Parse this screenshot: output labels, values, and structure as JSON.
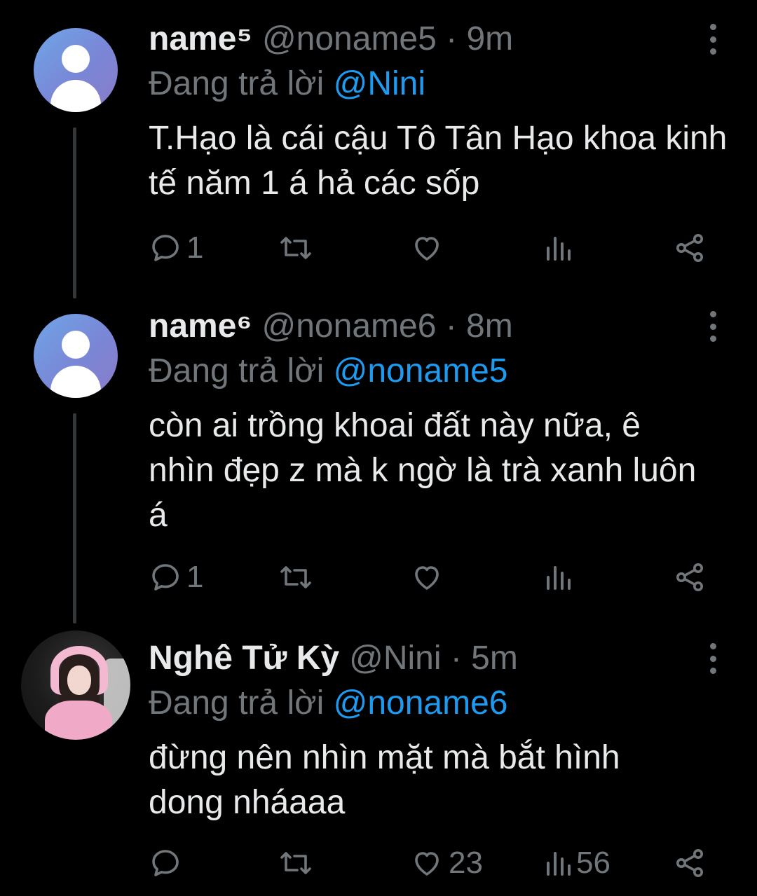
{
  "tweets": [
    {
      "display_name": "name⁵",
      "handle_time": "@noname5 · 9m",
      "replying_prefix": "Đang trả lời",
      "replying_to": "@Nini",
      "text": "T.Hạo là cái cậu Tô Tân Hạo khoa kinh tế năm 1 á hả các sốp",
      "reply_count": "1",
      "retweet_count": "",
      "like_count": "",
      "views_count": "",
      "avatar": "default-user-icon"
    },
    {
      "display_name": "name⁶",
      "handle_time": "@noname6 · 8m",
      "replying_prefix": "Đang trả lời",
      "replying_to": "@noname5",
      "text": "còn ai trồng khoai đất này nữa, ê nhìn đẹp z mà k ngờ là trà xanh luôn á",
      "reply_count": "1",
      "retweet_count": "",
      "like_count": "",
      "views_count": "",
      "avatar": "default-user-icon"
    },
    {
      "display_name": "Nghê Tử Kỳ",
      "handle_time": "@Nini · 5m",
      "replying_prefix": "Đang trả lời",
      "replying_to": "@noname6",
      "text": "đừng nên nhìn mặt mà bắt hình dong nháaaa",
      "reply_count": "",
      "retweet_count": "",
      "like_count": "23",
      "views_count": "56",
      "avatar": "profile-photo"
    }
  ],
  "colors": {
    "background": "#000000",
    "primary_text": "#e7e9ea",
    "secondary_text": "#71767b",
    "mention": "#1d9bf0",
    "thread_line": "#333639"
  },
  "icons": [
    "reply-icon",
    "retweet-icon",
    "like-icon",
    "views-icon",
    "share-icon",
    "more-options-icon"
  ]
}
